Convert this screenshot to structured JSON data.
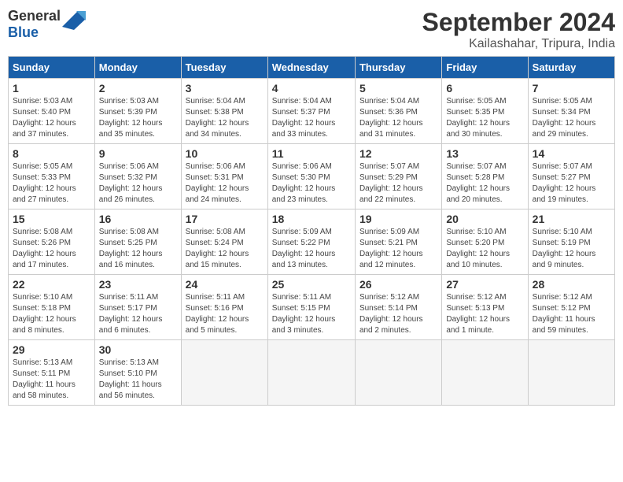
{
  "logo": {
    "line1": "General",
    "line2": "Blue"
  },
  "title": "September 2024",
  "subtitle": "Kailashahar, Tripura, India",
  "columns": [
    "Sunday",
    "Monday",
    "Tuesday",
    "Wednesday",
    "Thursday",
    "Friday",
    "Saturday"
  ],
  "days": [
    {
      "num": "",
      "info": ""
    },
    {
      "num": "",
      "info": ""
    },
    {
      "num": "",
      "info": ""
    },
    {
      "num": "",
      "info": ""
    },
    {
      "num": "",
      "info": ""
    },
    {
      "num": "",
      "info": ""
    },
    {
      "num": "",
      "info": ""
    },
    {
      "num": "1",
      "info": "Sunrise: 5:03 AM\nSunset: 5:40 PM\nDaylight: 12 hours\nand 37 minutes."
    },
    {
      "num": "2",
      "info": "Sunrise: 5:03 AM\nSunset: 5:39 PM\nDaylight: 12 hours\nand 35 minutes."
    },
    {
      "num": "3",
      "info": "Sunrise: 5:04 AM\nSunset: 5:38 PM\nDaylight: 12 hours\nand 34 minutes."
    },
    {
      "num": "4",
      "info": "Sunrise: 5:04 AM\nSunset: 5:37 PM\nDaylight: 12 hours\nand 33 minutes."
    },
    {
      "num": "5",
      "info": "Sunrise: 5:04 AM\nSunset: 5:36 PM\nDaylight: 12 hours\nand 31 minutes."
    },
    {
      "num": "6",
      "info": "Sunrise: 5:05 AM\nSunset: 5:35 PM\nDaylight: 12 hours\nand 30 minutes."
    },
    {
      "num": "7",
      "info": "Sunrise: 5:05 AM\nSunset: 5:34 PM\nDaylight: 12 hours\nand 29 minutes."
    },
    {
      "num": "8",
      "info": "Sunrise: 5:05 AM\nSunset: 5:33 PM\nDaylight: 12 hours\nand 27 minutes."
    },
    {
      "num": "9",
      "info": "Sunrise: 5:06 AM\nSunset: 5:32 PM\nDaylight: 12 hours\nand 26 minutes."
    },
    {
      "num": "10",
      "info": "Sunrise: 5:06 AM\nSunset: 5:31 PM\nDaylight: 12 hours\nand 24 minutes."
    },
    {
      "num": "11",
      "info": "Sunrise: 5:06 AM\nSunset: 5:30 PM\nDaylight: 12 hours\nand 23 minutes."
    },
    {
      "num": "12",
      "info": "Sunrise: 5:07 AM\nSunset: 5:29 PM\nDaylight: 12 hours\nand 22 minutes."
    },
    {
      "num": "13",
      "info": "Sunrise: 5:07 AM\nSunset: 5:28 PM\nDaylight: 12 hours\nand 20 minutes."
    },
    {
      "num": "14",
      "info": "Sunrise: 5:07 AM\nSunset: 5:27 PM\nDaylight: 12 hours\nand 19 minutes."
    },
    {
      "num": "15",
      "info": "Sunrise: 5:08 AM\nSunset: 5:26 PM\nDaylight: 12 hours\nand 17 minutes."
    },
    {
      "num": "16",
      "info": "Sunrise: 5:08 AM\nSunset: 5:25 PM\nDaylight: 12 hours\nand 16 minutes."
    },
    {
      "num": "17",
      "info": "Sunrise: 5:08 AM\nSunset: 5:24 PM\nDaylight: 12 hours\nand 15 minutes."
    },
    {
      "num": "18",
      "info": "Sunrise: 5:09 AM\nSunset: 5:22 PM\nDaylight: 12 hours\nand 13 minutes."
    },
    {
      "num": "19",
      "info": "Sunrise: 5:09 AM\nSunset: 5:21 PM\nDaylight: 12 hours\nand 12 minutes."
    },
    {
      "num": "20",
      "info": "Sunrise: 5:10 AM\nSunset: 5:20 PM\nDaylight: 12 hours\nand 10 minutes."
    },
    {
      "num": "21",
      "info": "Sunrise: 5:10 AM\nSunset: 5:19 PM\nDaylight: 12 hours\nand 9 minutes."
    },
    {
      "num": "22",
      "info": "Sunrise: 5:10 AM\nSunset: 5:18 PM\nDaylight: 12 hours\nand 8 minutes."
    },
    {
      "num": "23",
      "info": "Sunrise: 5:11 AM\nSunset: 5:17 PM\nDaylight: 12 hours\nand 6 minutes."
    },
    {
      "num": "24",
      "info": "Sunrise: 5:11 AM\nSunset: 5:16 PM\nDaylight: 12 hours\nand 5 minutes."
    },
    {
      "num": "25",
      "info": "Sunrise: 5:11 AM\nSunset: 5:15 PM\nDaylight: 12 hours\nand 3 minutes."
    },
    {
      "num": "26",
      "info": "Sunrise: 5:12 AM\nSunset: 5:14 PM\nDaylight: 12 hours\nand 2 minutes."
    },
    {
      "num": "27",
      "info": "Sunrise: 5:12 AM\nSunset: 5:13 PM\nDaylight: 12 hours\nand 1 minute."
    },
    {
      "num": "28",
      "info": "Sunrise: 5:12 AM\nSunset: 5:12 PM\nDaylight: 11 hours\nand 59 minutes."
    },
    {
      "num": "29",
      "info": "Sunrise: 5:13 AM\nSunset: 5:11 PM\nDaylight: 11 hours\nand 58 minutes."
    },
    {
      "num": "30",
      "info": "Sunrise: 5:13 AM\nSunset: 5:10 PM\nDaylight: 11 hours\nand 56 minutes."
    },
    {
      "num": "",
      "info": ""
    },
    {
      "num": "",
      "info": ""
    },
    {
      "num": "",
      "info": ""
    },
    {
      "num": "",
      "info": ""
    },
    {
      "num": "",
      "info": ""
    }
  ]
}
